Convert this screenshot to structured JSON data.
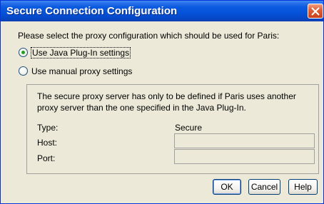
{
  "window": {
    "title": "Secure Connection Configuration"
  },
  "dialog": {
    "prompt": "Please select the proxy configuration which should be used for Paris:",
    "options": [
      {
        "label": "Use Java Plug-In settings",
        "selected": true
      },
      {
        "label": "Use manual proxy settings",
        "selected": false
      }
    ],
    "group": {
      "info": "The secure proxy server has only to be defined if Paris uses another proxy server than the one specified in the Java Plug-In.",
      "type_label": "Type:",
      "secure_label": "Secure",
      "host_label": "Host:",
      "host_value": "",
      "port_label": "Port:",
      "port_value": ""
    },
    "buttons": {
      "ok": "OK",
      "cancel": "Cancel",
      "help": "Help"
    }
  },
  "colors": {
    "titlebar": "#0552d8",
    "dialog_bg": "#ece9d8",
    "radio_dot": "#21a121",
    "close_button": "#e0603a"
  }
}
